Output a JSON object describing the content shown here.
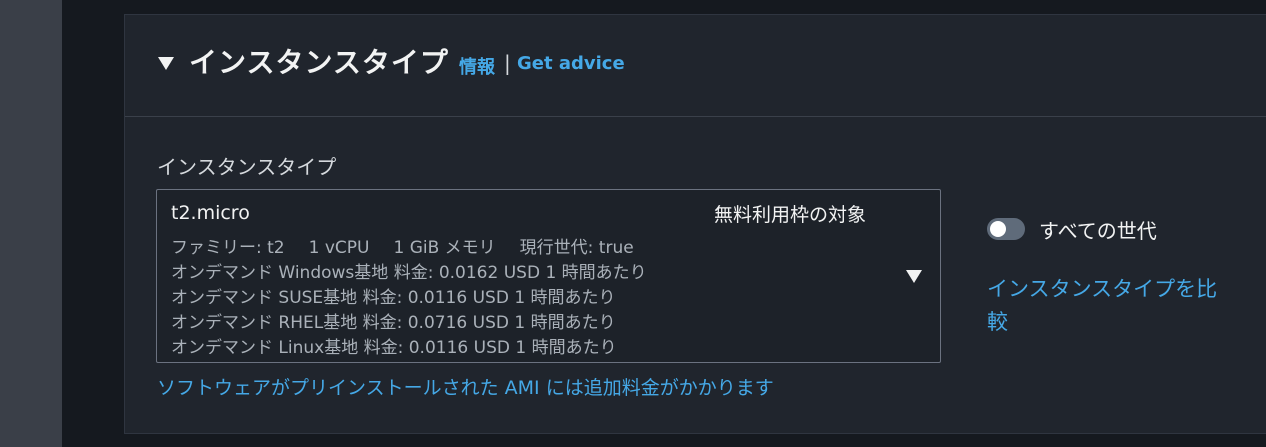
{
  "section": {
    "title": "インスタンスタイプ",
    "info_link": "情報",
    "separator": "|",
    "advice_link": "Get advice"
  },
  "field": {
    "label": "インスタンスタイプ",
    "selected": {
      "name": "t2.micro",
      "badge": "無料利用枠の対象",
      "family": "ファミリー: t2",
      "vcpu": "1 vCPU",
      "memory": "1 GiB メモリ",
      "generation": "現行世代: true",
      "pricing": [
        "オンデマンド Windows基地 料金: 0.0162 USD 1 時間あたり",
        "オンデマンド SUSE基地 料金: 0.0116 USD 1 時間あたり",
        "オンデマンド RHEL基地 料金: 0.0716 USD 1 時間あたり",
        "オンデマンド Linux基地 料金: 0.0116 USD 1 時間あたり"
      ]
    },
    "note": "ソフトウェアがプリインストールされた AMI には追加料金がかかります"
  },
  "side": {
    "toggle_label": "すべての世代",
    "toggle_on": false,
    "compare_link": "インスタンスタイプを比較"
  },
  "colors": {
    "link": "#45a8e6",
    "panel_bg": "#20252d",
    "text": "#f2f3f3",
    "muted": "#aab1b9"
  },
  "icons": {
    "section_caret": "caret-down-icon",
    "dropdown_caret": "caret-down-icon"
  }
}
